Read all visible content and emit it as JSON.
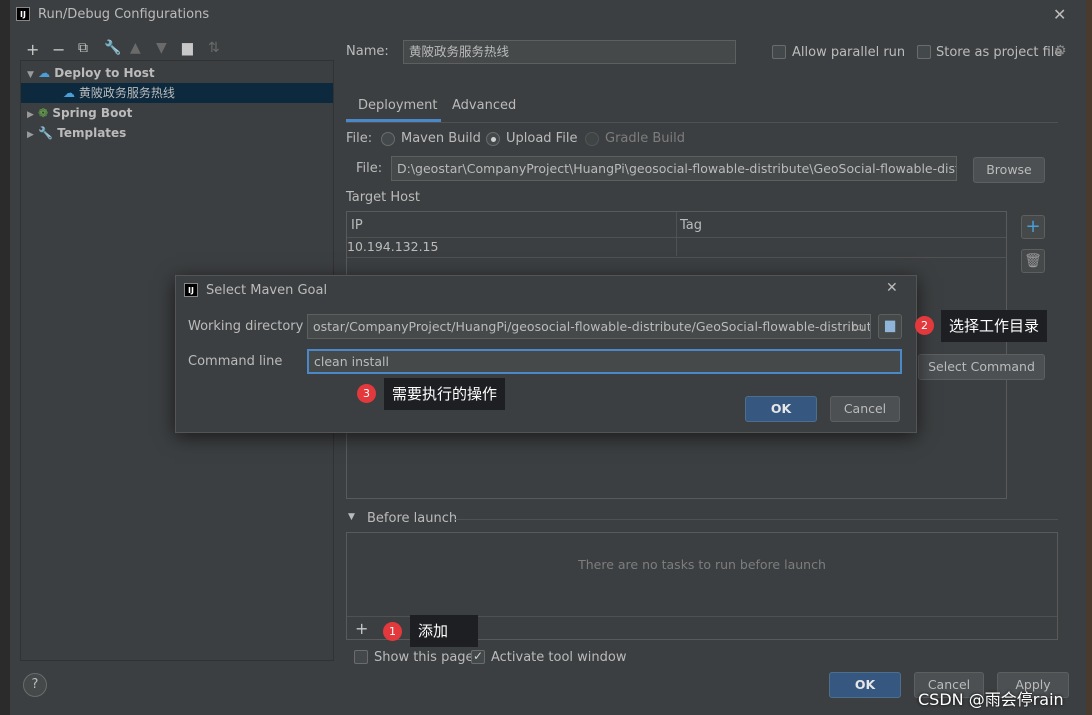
{
  "window": {
    "title": "Run/Debug Configurations"
  },
  "toolbar": {
    "icons": [
      "add-icon",
      "remove-icon",
      "copy-icon",
      "wrench-icon",
      "arrow-up-icon",
      "arrow-down-icon",
      "new-folder-icon",
      "sort-icon"
    ]
  },
  "tree": {
    "deploy_to_host": "Deploy to Host",
    "config_item": "黄陂政务服务热线",
    "spring_boot": "Spring Boot",
    "templates": "Templates"
  },
  "name_field": {
    "label": "Name:",
    "value": "黄陂政务服务热线"
  },
  "options": {
    "allow_parallel": "Allow parallel run",
    "store_project": "Store as project file"
  },
  "tabs": [
    {
      "label": "Deployment"
    },
    {
      "label": "Advanced"
    }
  ],
  "file_type": {
    "label": "File:",
    "options": [
      "Maven Build",
      "Upload File",
      "Gradle Build"
    ],
    "selected": "Upload File"
  },
  "file_path": {
    "label": "File:",
    "value": "D:\\geostar\\CompanyProject\\HuangPi\\geosocial-flowable-distribute\\GeoSocial-flowable-distribu",
    "browse": "Browse"
  },
  "target_host": {
    "label": "Target Host",
    "columns": [
      "IP",
      "Tag"
    ],
    "rows": [
      {
        "ip": "10.194.132.15",
        "tag": ""
      }
    ]
  },
  "select_command_label": "Select Command",
  "dialog": {
    "title": "Select Maven Goal",
    "working_dir_label": "Working directory",
    "working_dir_value": "ostar/CompanyProject/HuangPi/geosocial-flowable-distribute/GeoSocial-flowable-distribute",
    "command_label": "Command line",
    "command_value": "clean install",
    "ok": "OK",
    "cancel": "Cancel"
  },
  "callouts": {
    "one": {
      "number": "1",
      "text": "添加"
    },
    "two": {
      "number": "2",
      "text": "选择工作目录"
    },
    "three": {
      "number": "3",
      "text": "需要执行的操作"
    }
  },
  "before_launch": {
    "label": "Before launch",
    "empty_text": "There are no tasks to run before launch"
  },
  "bottom": {
    "show_page": "Show this page",
    "activate_window": "Activate tool window",
    "ok": "OK",
    "cancel": "Cancel",
    "apply": "Apply",
    "help": "?"
  },
  "watermark": "CSDN @雨会停rain",
  "colors": {
    "accent": "#4a88c7",
    "primary_button": "#365880",
    "badge": "#e4393c",
    "selection": "#0d293e"
  }
}
